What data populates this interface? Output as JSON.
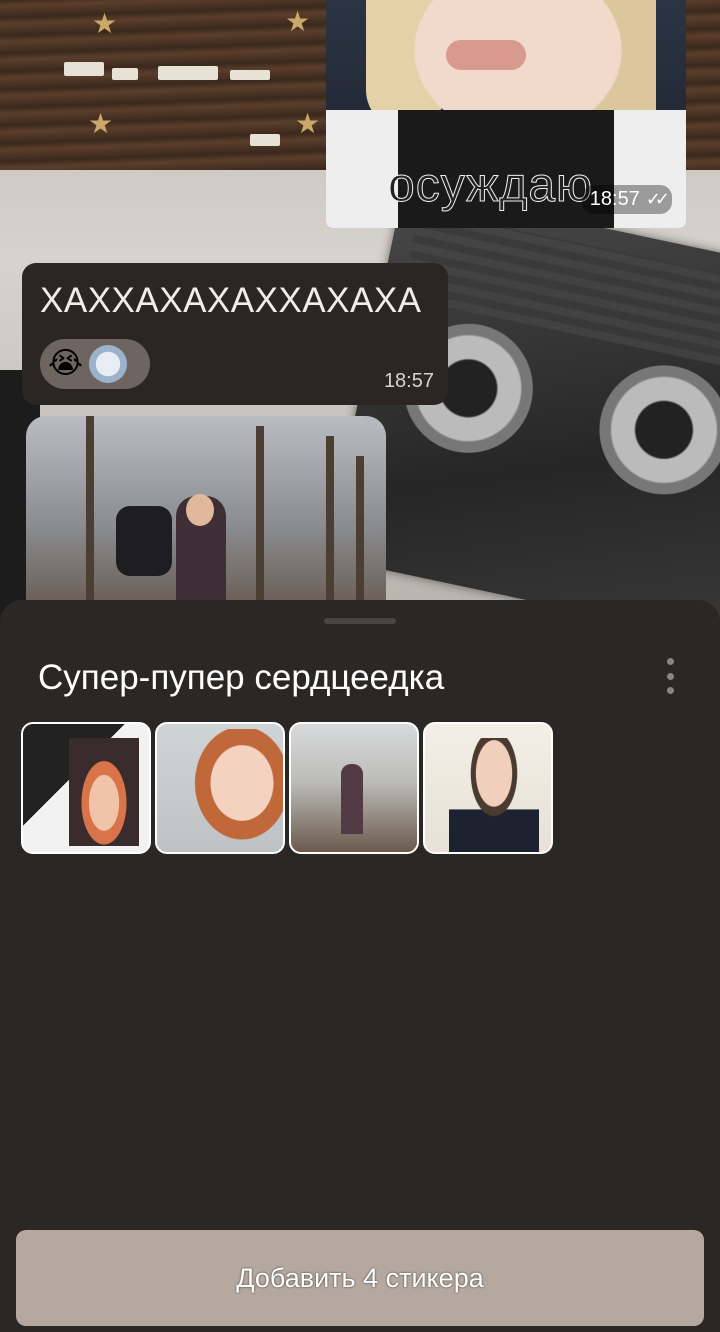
{
  "chat": {
    "messages": [
      {
        "type": "photo",
        "caption": "осуждаю",
        "time": "18:57",
        "status": "read"
      },
      {
        "type": "text",
        "text": "ХАХХАХАХАХХАХАХА",
        "time": "18:57",
        "reaction_emoji": "😭"
      },
      {
        "type": "photo"
      }
    ]
  },
  "sticker_sheet": {
    "title": "Супер-пупер сердцеедка",
    "stickers": [
      {
        "name": "sticker-1"
      },
      {
        "name": "sticker-2"
      },
      {
        "name": "sticker-3"
      },
      {
        "name": "sticker-4"
      }
    ],
    "add_button_label": "Добавить 4 стикера"
  },
  "colors": {
    "sheet_bg": "#2b2725",
    "button_bg": "#b5a99f",
    "bubble_bg": "#2b2523"
  }
}
